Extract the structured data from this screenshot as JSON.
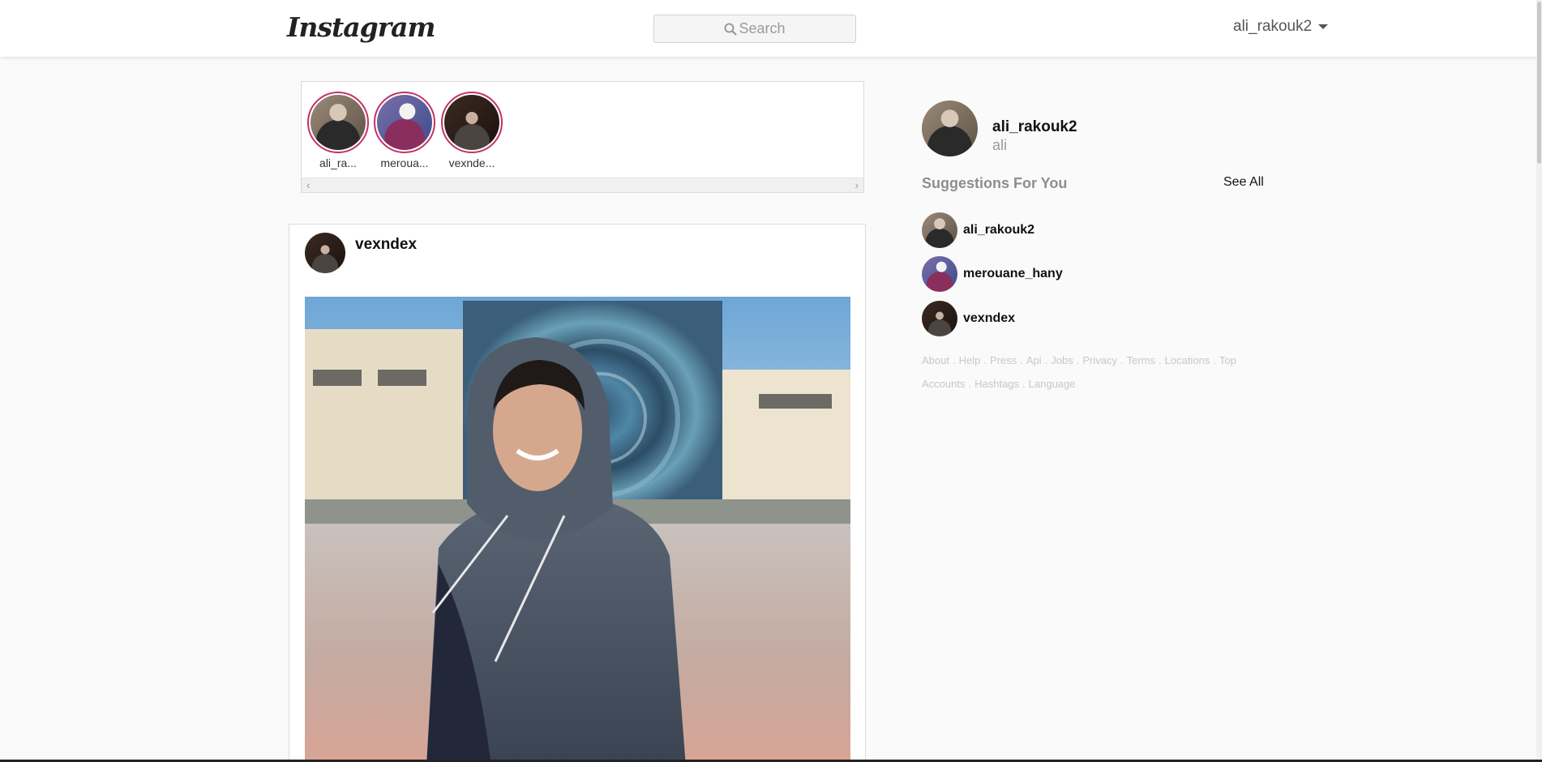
{
  "nav": {
    "logo": "Instagram",
    "search_placeholder": "Search",
    "user_menu_label": "ali_rakouk2"
  },
  "stories": [
    {
      "label": "ali_ra...",
      "avatar": "av-a"
    },
    {
      "label": "meroua...",
      "avatar": "av-m"
    },
    {
      "label": "vexnde...",
      "avatar": "av-v"
    }
  ],
  "post": {
    "username": "vexndex"
  },
  "sidebar": {
    "username": "ali_rakouk2",
    "full_name": "ali",
    "suggestions_title": "Suggestions For You",
    "see_all": "See All",
    "suggestions": [
      {
        "username": "ali_rakouk2"
      },
      {
        "username": "merouane_hany"
      },
      {
        "username": "vexndex"
      }
    ],
    "footer_links": [
      "About",
      "Help",
      "Press",
      "Api",
      "Jobs",
      "Privacy",
      "Terms",
      "Locations",
      "Top Accounts",
      "Hashtags",
      "Language"
    ]
  },
  "colors": {
    "story_ring": "#c43265",
    "background": "#fafafa"
  }
}
